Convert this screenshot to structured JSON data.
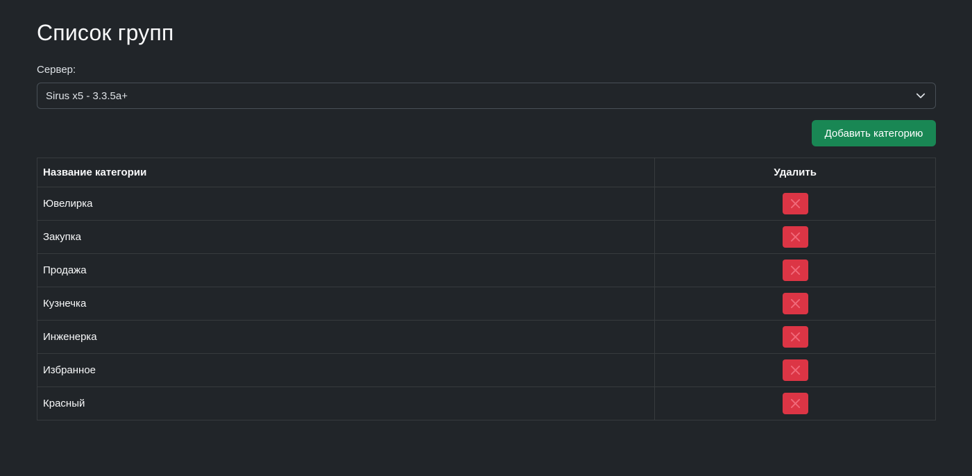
{
  "page": {
    "title": "Список групп"
  },
  "server": {
    "label": "Сервер:",
    "selected": "Sirus x5 - 3.3.5a+"
  },
  "toolbar": {
    "add_label": "Добавить категорию"
  },
  "table": {
    "columns": [
      "Название категории",
      "Удалить"
    ],
    "rows": [
      {
        "name": "Ювелирка"
      },
      {
        "name": "Закупка"
      },
      {
        "name": "Продажа"
      },
      {
        "name": "Кузнечка"
      },
      {
        "name": "Инженерка"
      },
      {
        "name": "Избранное"
      },
      {
        "name": "Красный"
      }
    ]
  },
  "icons": {
    "delete": "close-icon",
    "select": "chevron-down-icon"
  },
  "colors": {
    "background": "#212529",
    "success": "#198754",
    "danger": "#dc3545",
    "delete_icon": "#f06a7a"
  }
}
